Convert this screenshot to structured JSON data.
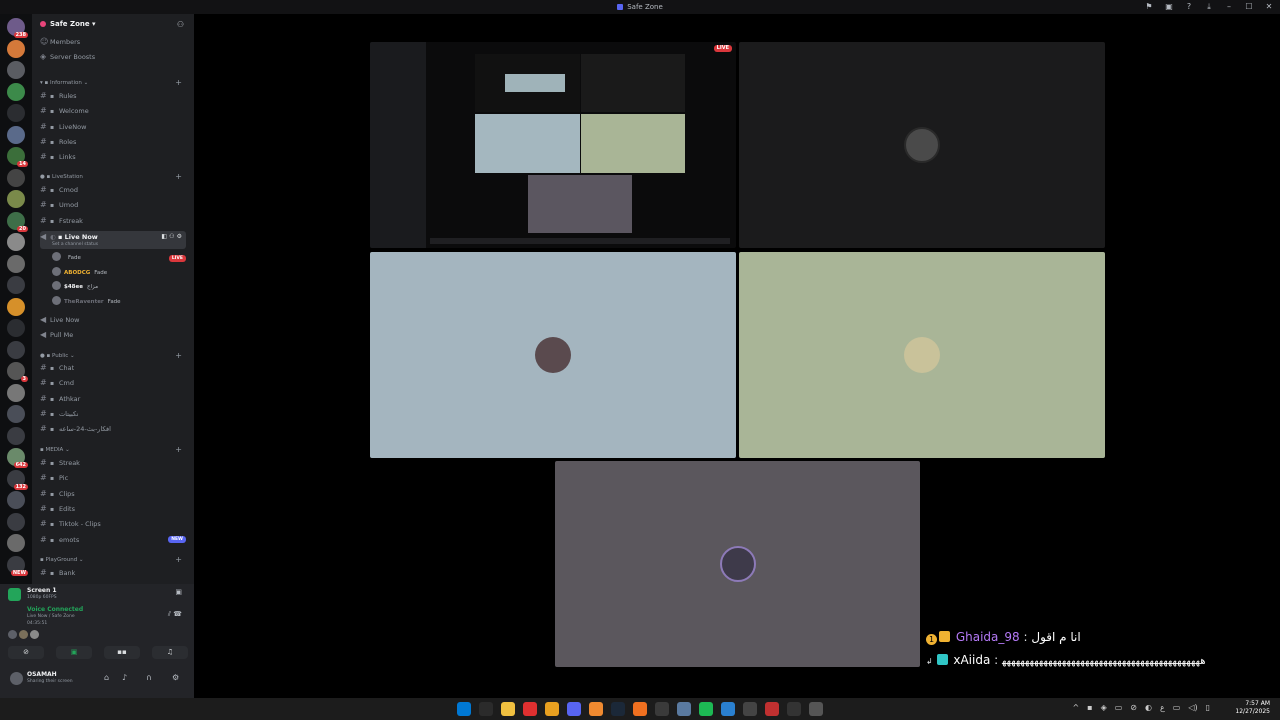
{
  "window": {
    "title": "Safe Zone"
  },
  "colors": {
    "accent": "#5865f2",
    "live": "#da373c",
    "online": "#23a55a"
  },
  "servers": [
    {
      "badge": "238"
    },
    {
      "badge": ""
    },
    {
      "badge": ""
    },
    {
      "badge": ""
    },
    {
      "badge": ""
    },
    {
      "badge": ""
    },
    {
      "badge": "14"
    },
    {
      "badge": ""
    },
    {
      "badge": ""
    },
    {
      "badge": "20"
    },
    {
      "badge": ""
    },
    {
      "badge": ""
    },
    {
      "badge": ""
    },
    {
      "badge": ""
    },
    {
      "badge": ""
    },
    {
      "badge": ""
    },
    {
      "badge": "3"
    },
    {
      "badge": ""
    },
    {
      "badge": ""
    },
    {
      "badge": ""
    },
    {
      "badge": "642"
    },
    {
      "badge": "132"
    },
    {
      "badge": ""
    },
    {
      "badge": ""
    },
    {
      "badge": ""
    },
    {
      "badge": "NEW"
    }
  ],
  "sidebar": {
    "server_name": "Safe Zone",
    "top": {
      "members": "Members",
      "boosts": "Server Boosts"
    },
    "cat_information": "Information",
    "info_channels": [
      "Rules",
      "Welcome",
      "LiveNow",
      "Roles",
      "Links"
    ],
    "cat_livestation": "LiveStation",
    "live_channels": [
      "Cmod",
      "Umod",
      "Fstreak"
    ],
    "active_channel": {
      "name": "Live Now",
      "status": "Set a channel status"
    },
    "voice_users": [
      {
        "name": "",
        "tag": "Fade",
        "live": "LIVE"
      },
      {
        "name": "ABODCG",
        "tag": "Fade",
        "live": ""
      },
      {
        "name": "$48ee",
        "tag": "ﻣﺰﺍﺝ",
        "live": ""
      },
      {
        "name": "TheRaventer",
        "tag": "Fade",
        "live": ""
      }
    ],
    "more_voice": [
      "Live Now",
      "Pull Me"
    ],
    "cat_public": "Public",
    "public_channels": [
      "Chat",
      "Cmd",
      "Athkar",
      "ﻧﻜﺒﻴﺘﺎﺕ",
      "ﺍﻓﻜﺎﺭ-ﺑﺚ-24-ﺳﺎﻋﻪ"
    ],
    "cat_media": "MEDIA",
    "media_channels": [
      "Streak",
      "Pic",
      "Clips",
      "Edits",
      "Tiktok - Clips",
      "emots"
    ],
    "new_label": "NEW",
    "cat_playground": "PlayGround",
    "playground_channels": [
      "Bank"
    ]
  },
  "panel": {
    "screen_title": "Screen 1",
    "screen_sub": "1080p 60FPS",
    "voice_connected": "Voice Connected",
    "voice_channel": "Live Now / Safe Zone",
    "voice_time": "04:35:51",
    "username": "OSAMAH",
    "user_status": "Sharing their screen"
  },
  "stream": {
    "live": "LIVE"
  },
  "chat": [
    {
      "badge": "1",
      "name": "Ghaida_98",
      "message": "ﺍﻧﺎ ﻡ ﺍﻗﻮﻝ"
    },
    {
      "badge": "",
      "name": "xAiida",
      "message": "ﻫﻬﻬﻬﻬﻬﻬﻬﻬﻬﻬﻬﻬﻬﻬﻬﻬﻬﻬﻬﻬﻬﻬﻬﻬﻬﻬﻬﻬﻬﻬﻬﻬﻬﻬﻬﻬﻬﻬﻬﻬﻬﻬﻬ"
    }
  ],
  "taskbar": {
    "time": "7:57 AM",
    "date": "12/27/2025"
  }
}
